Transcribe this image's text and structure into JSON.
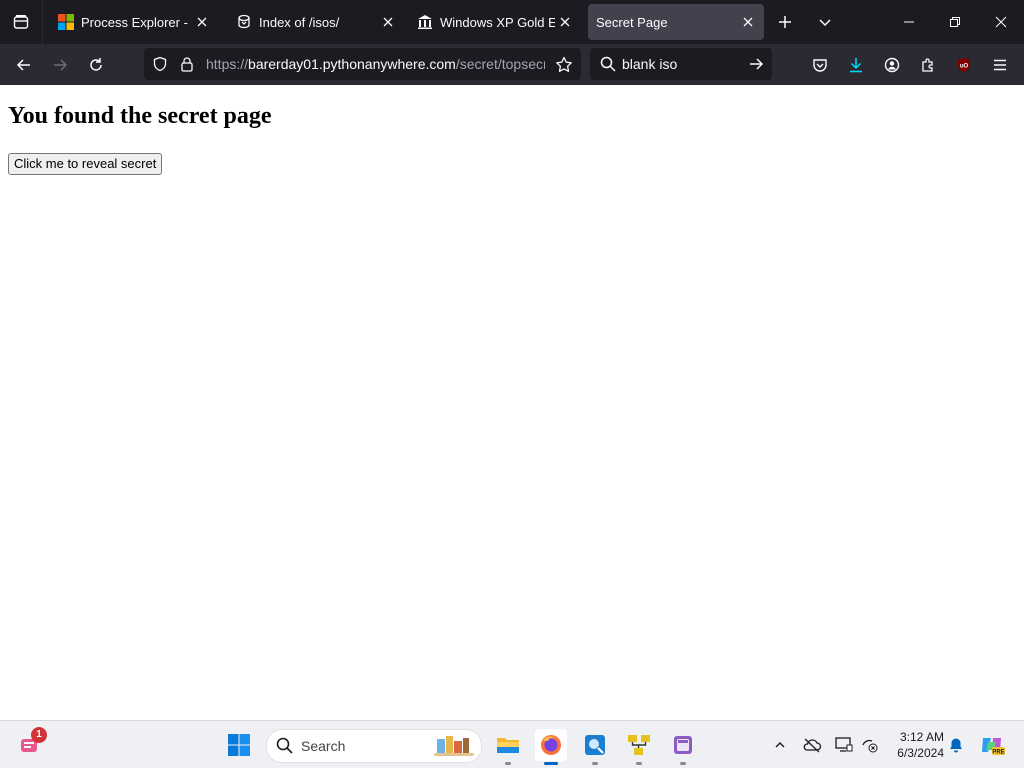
{
  "browser": {
    "tabs": [
      {
        "title": "Process Explorer - Sysinternals",
        "active": false,
        "icon": "microsoft-icon"
      },
      {
        "title": "Index of /isos/",
        "active": false,
        "icon": "archive-icon"
      },
      {
        "title": "Windows XP Gold Edition",
        "active": false,
        "icon": "library-icon"
      },
      {
        "title": "Secret Page",
        "active": true,
        "icon": ""
      }
    ],
    "url": {
      "scheme": "https://",
      "host": "barerday01.pythonanywhere.com",
      "path": "/secret/topsecret"
    },
    "search_query": "blank iso",
    "accent_color": "#0060df"
  },
  "page": {
    "heading": "You found the secret page",
    "button_label": "Click me to reveal secret"
  },
  "taskbar": {
    "search_label": "Search",
    "notification_count": "1",
    "time": "3:12 AM",
    "date": "6/3/2024",
    "copilot_label": "PRE"
  }
}
